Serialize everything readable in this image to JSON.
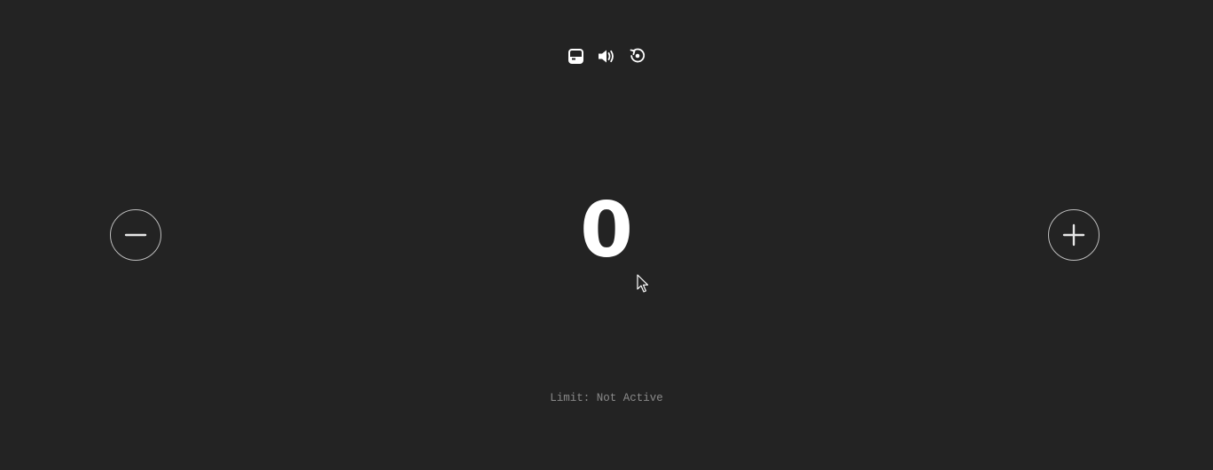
{
  "toolbar": {
    "icons": [
      "theme-toggle-icon",
      "sound-icon",
      "reset-icon"
    ]
  },
  "counter": {
    "value": "0"
  },
  "controls": {
    "decrement_icon": "minus-icon",
    "increment_icon": "plus-icon"
  },
  "limit": {
    "text": "Limit: Not Active"
  },
  "colors": {
    "background": "#232323",
    "foreground": "#ffffff",
    "muted": "#8a8a8a",
    "circle_border": "#bdbdbd"
  }
}
